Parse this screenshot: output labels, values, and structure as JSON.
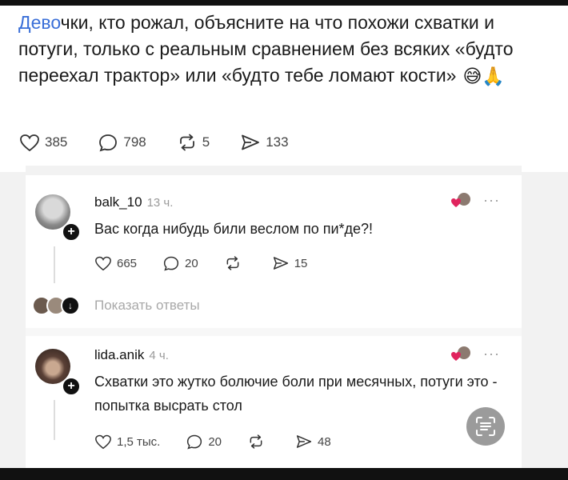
{
  "post": {
    "text_highlight": "Дево",
    "text_rest": "чки, кто рожал, объясните на что похожи схватки и потуги, только с реальным сравнением без всяких «будто переехал трактор» или «будто тебе ломают кости»",
    "emojis": "😅🙏",
    "likes": "385",
    "comments": "798",
    "reposts": "5",
    "shares": "133"
  },
  "comments": [
    {
      "username": "balk_10",
      "time": "13 ч.",
      "text": "Вас когда нибудь били веслом по пи*де?!",
      "likes": "665",
      "replies": "20",
      "reposts": "",
      "shares": "15",
      "show_replies": "Показать ответы"
    },
    {
      "username": "lida.anik",
      "time": "4 ч.",
      "text": "Схватки это жутко болючие боли при месячных, потуги это - попытка высрать стол",
      "likes": "1,5 тыс.",
      "replies": "20",
      "reposts": "",
      "shares": "48"
    }
  ],
  "colors": {
    "link": "#3a6fd8",
    "muted": "#9a9a9a",
    "like_heart": "#e0245e"
  },
  "icons": [
    "heart-icon",
    "comment-icon",
    "repost-icon",
    "share-icon",
    "more-icon",
    "plus-icon",
    "text-recognition-icon"
  ]
}
